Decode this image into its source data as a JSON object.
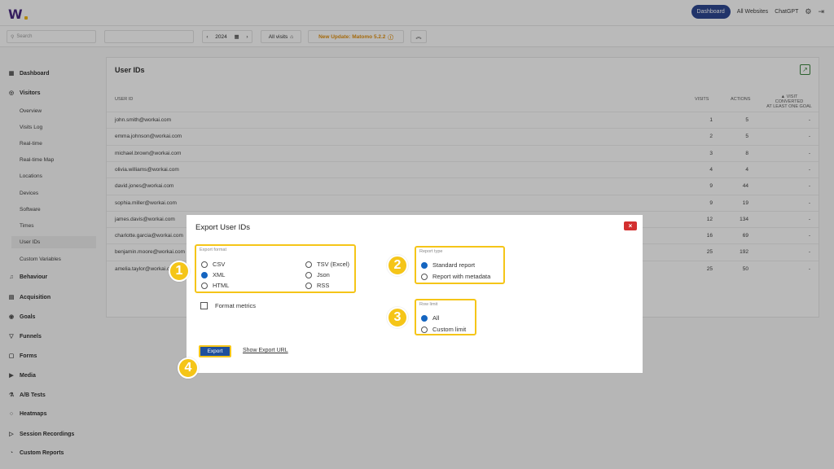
{
  "brand": {
    "logo_letter": "W"
  },
  "topnav": {
    "dashboard": "Dashboard",
    "all_websites": "All Websites",
    "chatgpt": "ChatGPT"
  },
  "toolbar": {
    "search_placeholder": "Search",
    "year": "2024",
    "segment": "All visits",
    "update_notice": "New Update: Matomo 5.2.2"
  },
  "sidebar": {
    "dashboard": "Dashboard",
    "visitors": "Visitors",
    "visitor_items": [
      "Overview",
      "Visits Log",
      "Real-time",
      "Real-time Map",
      "Locations",
      "Devices",
      "Software",
      "Times",
      "User IDs",
      "Custom Variables"
    ],
    "sections": [
      "Behaviour",
      "Acquisition",
      "Goals",
      "Funnels",
      "Forms",
      "Media",
      "A/B Tests",
      "Heatmaps",
      "Session Recordings",
      "Custom Reports"
    ]
  },
  "report": {
    "title": "User IDs",
    "columns": {
      "user_id": "USER ID",
      "visits": "VISITS",
      "actions": "ACTIONS",
      "goal_line1": "▲ VISIT CONVERTED",
      "goal_line2": "AT LEAST ONE GOAL"
    },
    "rows": [
      {
        "user": "john.smith@workai.com",
        "visits": "1",
        "actions": "5",
        "goal": "-"
      },
      {
        "user": "emma.johnson@workai.com",
        "visits": "2",
        "actions": "5",
        "goal": "-"
      },
      {
        "user": "michael.brown@workai.com",
        "visits": "3",
        "actions": "8",
        "goal": "-"
      },
      {
        "user": "olivia.williams@workai.com",
        "visits": "4",
        "actions": "4",
        "goal": "-"
      },
      {
        "user": "david.jones@workai.com",
        "visits": "9",
        "actions": "44",
        "goal": "-"
      },
      {
        "user": "sophia.miller@workai.com",
        "visits": "9",
        "actions": "19",
        "goal": "-"
      },
      {
        "user": "james.davis@workai.com",
        "visits": "12",
        "actions": "134",
        "goal": "-"
      },
      {
        "user": "charlotte.garcia@workai.com",
        "visits": "16",
        "actions": "69",
        "goal": "-"
      },
      {
        "user": "benjamin.moore@workai.com",
        "visits": "25",
        "actions": "192",
        "goal": "-"
      },
      {
        "user": "amelia.taylor@workai.com",
        "visits": "25",
        "actions": "50",
        "goal": "-"
      }
    ]
  },
  "modal": {
    "title": "Export User IDs",
    "close": "×",
    "export_format_label": "Export format",
    "formats": [
      {
        "label": "CSV",
        "selected": false
      },
      {
        "label": "XML",
        "selected": true
      },
      {
        "label": "HTML",
        "selected": false
      },
      {
        "label": "TSV (Excel)",
        "selected": false
      },
      {
        "label": "Json",
        "selected": false
      },
      {
        "label": "RSS",
        "selected": false
      }
    ],
    "format_metrics": "Format metrics",
    "report_type_label": "Report type",
    "report_types": [
      {
        "label": "Standard report",
        "selected": true
      },
      {
        "label": "Report with metadata",
        "selected": false
      }
    ],
    "row_limit_label": "Row limit",
    "row_limits": [
      {
        "label": "All",
        "selected": true
      },
      {
        "label": "Custom limit",
        "selected": false
      }
    ],
    "export_button": "Export",
    "show_url": "Show Export URL"
  },
  "badges": [
    "1",
    "2",
    "3",
    "4"
  ],
  "colors": {
    "brand": "#3d1a7a",
    "primary": "#1e3a8a",
    "highlight": "#f5c518",
    "close": "#d32f2f",
    "update": "#e08a00"
  }
}
